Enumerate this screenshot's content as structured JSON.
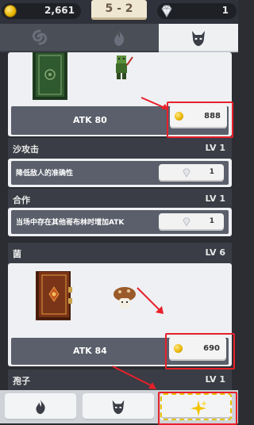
{
  "topbar": {
    "gold": "2,661",
    "stage": "5 - 2",
    "gems": "1"
  },
  "tabs": [
    {
      "icon": "swirl-icon",
      "active": false
    },
    {
      "icon": "flame-icon",
      "active": false
    },
    {
      "icon": "demon-mask-icon",
      "active": true
    }
  ],
  "cards": [
    {
      "atk_label": "ATK 80",
      "cost": "888",
      "book_color": "#2f5a2f"
    },
    {
      "name": "沙攻击",
      "level": "LV 1",
      "desc": "降低敌人的准确性",
      "gem_cost": "1"
    },
    {
      "name": "合作",
      "level": "LV 1",
      "desc": "当场中存在其他哥布林时增加ATK",
      "gem_cost": "1"
    },
    {
      "name": "菌",
      "level": "LV 6",
      "atk_label": "ATK 84",
      "cost": "690",
      "book_color": "#7a3418"
    },
    {
      "name": "孢子",
      "level": "LV 1"
    }
  ],
  "bottom_buttons": [
    {
      "icon": "flame-icon"
    },
    {
      "icon": "demon-mask-icon"
    },
    {
      "icon": "sparkle-icon"
    }
  ],
  "colors": {
    "highlight": "#e8202a",
    "panel": "#eef0f3",
    "row": "#5a5f6b",
    "header": "#3a3d45"
  }
}
